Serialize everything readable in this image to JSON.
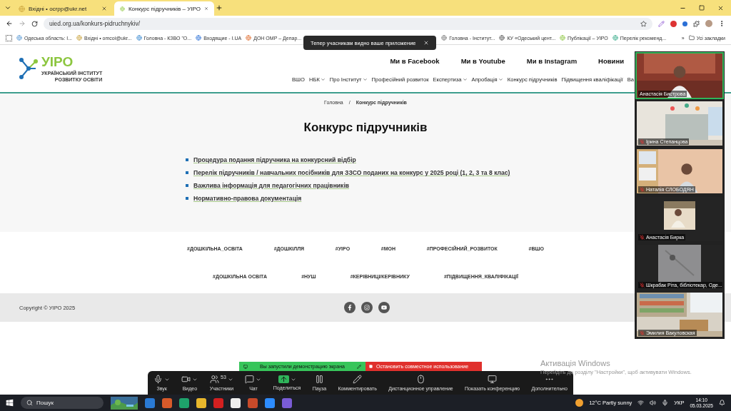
{
  "browser": {
    "tabs": [
      {
        "title": "Вхідні • ocrpp@ukr.net",
        "selected": false
      },
      {
        "title": "Конкурс підручників – УІРО",
        "selected": true
      }
    ],
    "address": "uied.org.ua/konkurs-pidruchnykiv/",
    "bookmarks": [
      "Одеська область: І...",
      "Вхідні • omcoi@ukr...",
      "Головна - КЗВО \"О...",
      "Входящие - I.UA",
      "ДОН ОМР – Депар...",
      "Головна - Інститут...",
      "КУ «Одеський цент...",
      "Публікації – УІРО",
      "Перелік рекоменд..."
    ],
    "more": "»",
    "all_bookmarks": "Усі закладки"
  },
  "notification": "Тепер учасникам видно ваше приложение",
  "site": {
    "logo": {
      "name": "УІРО",
      "subtitle": [
        "УКРАЇНСЬКИЙ ІНСТИТУТ",
        "РОЗВИТКУ ОСВІТИ"
      ]
    },
    "social_links": [
      "Ми в Facebook",
      "Ми в Youtube",
      "Ми в Instagram",
      "Новини"
    ],
    "nav": [
      {
        "label": "ВШО",
        "dropdown": false
      },
      {
        "label": "НБК",
        "dropdown": true
      },
      {
        "label": "Про Інститут",
        "dropdown": true
      },
      {
        "label": "Професійний розвиток",
        "dropdown": false
      },
      {
        "label": "Експертиза",
        "dropdown": true
      },
      {
        "label": "Апробація",
        "dropdown": true
      },
      {
        "label": "Конкурс підручників",
        "dropdown": false
      },
      {
        "label": "Підвищення кваліфікації",
        "dropdown": false
      },
      {
        "label": "Ва",
        "dropdown": false
      }
    ],
    "breadcrumb": [
      "Головна",
      "/",
      "Конкурс підручників"
    ],
    "title": "Конкурс підручників",
    "links": [
      "Процедура подання підручника на конкурсний відбір",
      "Перелік підручників / навчальних посібників для ЗЗСО поданих на конкурс у 2025 році (1, 2, 3 та 8 клас)",
      "Важлива інформація для педагогічних працівників",
      "Нормативно-правова документація"
    ],
    "tags": [
      [
        "#ДОШКІЛЬНА_ОСВІТА",
        "#ДОШКІЛЛЯ",
        "#УІРО",
        "#МОН",
        "#ПРОФЕСІЙНИЙ_РОЗВИТОК",
        "#ВШО"
      ],
      [
        "#ДОШКІЛЬНА ОСВІТА",
        "#НУШ",
        "#КЕРІВНИЦІ/КЕРІВНИКУ",
        "#ПІДВИЩЕННЯ_КВАЛІФІКАЦІЇ"
      ]
    ],
    "copyright": "Copyright © УІРО 2025"
  },
  "participants": [
    {
      "name": "Анастасія Бистрова",
      "muted": false,
      "active": true
    },
    {
      "name": "Ірина Степанцова",
      "muted": true,
      "active": false
    },
    {
      "name": "Наталія СЛОБОДЯН",
      "muted": true,
      "active": false
    },
    {
      "name": "Анастасія Бирка",
      "muted": true,
      "active": false
    },
    {
      "name": "Шкрабак Ріта, бібліотекар, Оде...",
      "muted": true,
      "active": false
    },
    {
      "name": "Эмилия Вакуловская",
      "muted": true,
      "active": false
    }
  ],
  "share_banner": {
    "status": "Вы запустили демонстрацию экрана",
    "stop": "Остановить совместное использование"
  },
  "toolbar": [
    {
      "kind": "mic",
      "label": "Звук",
      "caret": true
    },
    {
      "kind": "video",
      "label": "Видео",
      "caret": true
    },
    {
      "kind": "participants",
      "label": "Участники",
      "caret": true,
      "badge": "53"
    },
    {
      "kind": "chat",
      "label": "Чат",
      "caret": true
    },
    {
      "kind": "share",
      "label": "Поделиться",
      "caret": true
    },
    {
      "kind": "pause",
      "label": "Пауза",
      "caret": false
    },
    {
      "kind": "annotate",
      "label": "Комментировать",
      "caret": false
    },
    {
      "kind": "remote",
      "label": "Дистанционное управление",
      "caret": false
    },
    {
      "kind": "show",
      "label": "Показать конференцию",
      "caret": false
    },
    {
      "kind": "more",
      "label": "Дополнительно",
      "caret": false
    }
  ],
  "activation": {
    "title": "Активація Windows",
    "text": "Перейдіть до розділу \"Настройки\", щоб активувати Windows."
  },
  "taskbar": {
    "search": "Пошук",
    "weather": "12°C  Partly sunny",
    "language": "УКР",
    "time": "14:10",
    "date": "05.03.2025"
  }
}
